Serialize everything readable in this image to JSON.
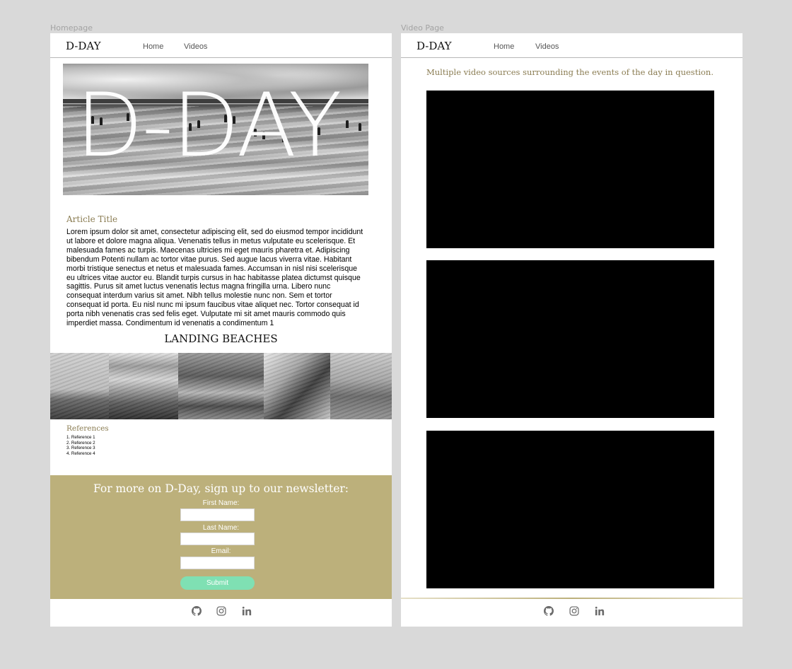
{
  "artboards": {
    "homepage": "Homepage",
    "video_page": "Video Page"
  },
  "nav": {
    "brand": "D-DAY",
    "home": "Home",
    "videos": "Videos"
  },
  "homepage": {
    "hero_text": "D-DAY",
    "article_title": "Article Title",
    "article_body": "Lorem ipsum dolor sit amet, consectetur adipiscing elit, sed do eiusmod tempor incididunt ut labore et dolore magna aliqua. Venenatis tellus in metus vulputate eu scelerisque. Et malesuada fames ac turpis. Maecenas ultricies mi eget mauris pharetra et. Adipiscing bibendum Potenti nullam ac tortor vitae purus. Sed augue lacus viverra vitae. Habitant morbi tristique senectus et netus et malesuada fames. Accumsan in nisl nisi scelerisque eu ultrices vitae auctor eu. Blandit turpis cursus in hac habitasse platea dictumst quisque sagittis. Purus sit amet luctus venenatis lectus magna fringilla urna. Libero nunc consequat interdum varius sit amet. Nibh tellus molestie nunc non. Sem et tortor consequat id porta. Eu nisl nunc mi ipsum faucibus vitae aliquet nec. Tortor consequat id porta nibh venenatis cras sed felis eget. Vulputate mi sit amet mauris commodo quis imperdiet massa. Condimentum id venenatis a condimentum 1",
    "section_heading": "LANDING BEACHES",
    "references_title": "References",
    "references": [
      "1. Reference 1",
      "2. Reference 2",
      "3. Reference 3",
      "4. Reference 4"
    ],
    "newsletter": {
      "heading": "For more on D-Day, sign up to our newsletter:",
      "first_name_label": "First Name:",
      "last_name_label": "Last Name:",
      "email_label": "Email:",
      "submit_label": "Submit"
    }
  },
  "video_page": {
    "intro": "Multiple video sources surrounding the events of the day in question."
  },
  "footer": {
    "icons": [
      "github-icon",
      "instagram-icon",
      "linkedin-icon"
    ]
  },
  "colors": {
    "accent_gold": "#bcb07b",
    "title_gold": "#8a7c52",
    "submit_green": "#7fe0b3",
    "canvas": "#d9d9d9"
  }
}
